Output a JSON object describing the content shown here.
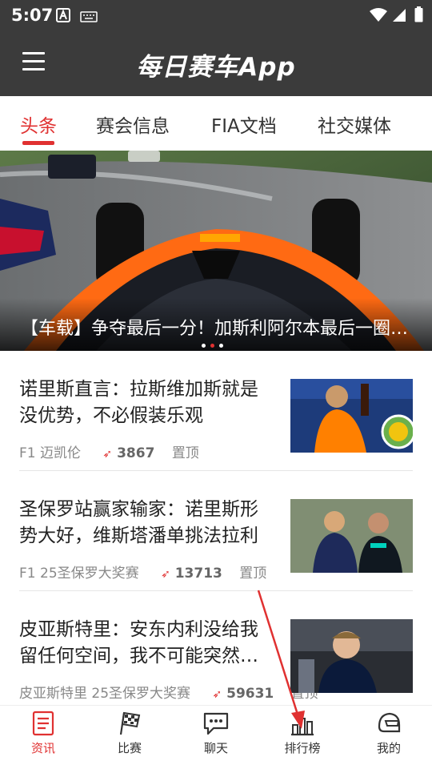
{
  "status_bar": {
    "time": "5:07",
    "icons": [
      "keyboard-a-icon",
      "keyboard-icon",
      "wifi-icon",
      "signal-icon",
      "battery-icon"
    ]
  },
  "app_bar": {
    "title": "每日赛车App",
    "menu_icon": "hamburger-menu-icon"
  },
  "tabs": [
    {
      "label": "头条",
      "active": true
    },
    {
      "label": "赛会信息",
      "active": false
    },
    {
      "label": "FIA文档",
      "active": false
    },
    {
      "label": "社交媒体",
      "active": false
    }
  ],
  "banner": {
    "title": "【车载】争夺最后一分！加斯利阿尔本最后一圈缠斗",
    "page_count": 3,
    "current_page": 2
  },
  "news": [
    {
      "title": "诺里斯直言：拉斯维加斯就是没优势，不必假装乐观",
      "tag": "F1",
      "source": "迈凯伦",
      "views": "3867",
      "pin": "置顶"
    },
    {
      "title": "圣保罗站赢家输家：诺里斯形势大好，维斯塔潘单挑法拉利",
      "tag": "F1",
      "source": "25圣保罗大奖赛",
      "views": "13713",
      "pin": "置顶"
    },
    {
      "title": "皮亚斯特里：安东内利没给我留任何空间，我不可能突然消失",
      "tag": "皮亚斯特里",
      "source": "25圣保罗大奖赛",
      "views": "59631",
      "pin": "置顶"
    }
  ],
  "bottom_nav": [
    {
      "label": "资讯",
      "icon": "news-document-icon",
      "active": true
    },
    {
      "label": "比赛",
      "icon": "checkered-flag-icon",
      "active": false
    },
    {
      "label": "聊天",
      "icon": "chat-bubble-icon",
      "active": false
    },
    {
      "label": "排行榜",
      "icon": "leaderboard-chart-icon",
      "active": false
    },
    {
      "label": "我的",
      "icon": "helmet-icon",
      "active": false
    }
  ],
  "colors": {
    "accent": "#e03131",
    "appbar": "#3b3b3b",
    "text": "#222222",
    "muted": "#888888"
  }
}
